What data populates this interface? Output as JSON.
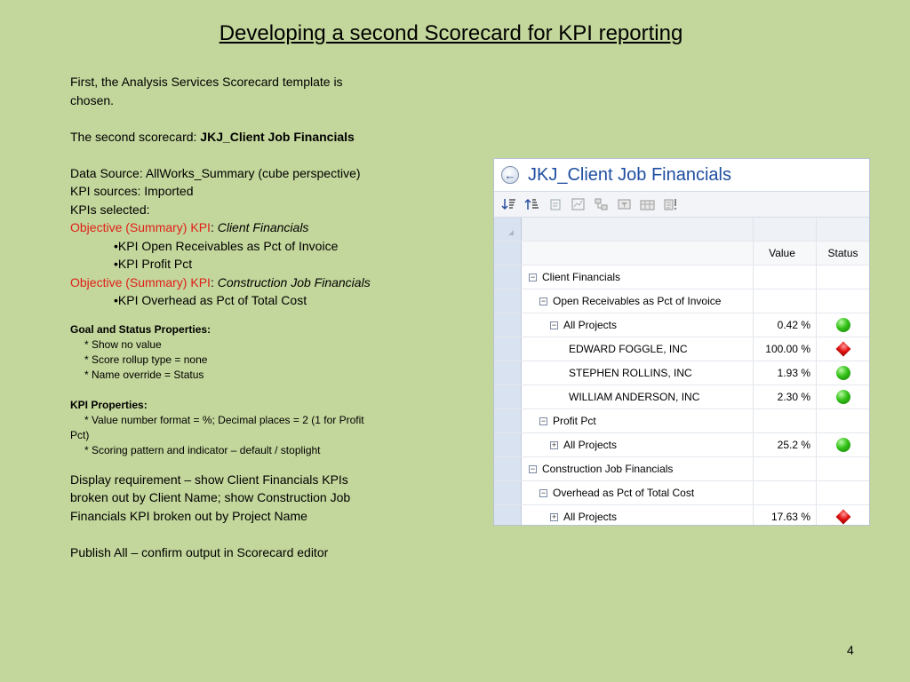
{
  "slide": {
    "title": "Developing a second Scorecard for KPI reporting",
    "page_number": "4"
  },
  "text": {
    "intro1": "First, the Analysis Services Scorecard template is chosen.",
    "second_label": "The second scorecard: ",
    "second_name": "JKJ_Client Job Financials",
    "datasource1": "Data Source: AllWorks_Summary (cube perspective)",
    "kpi_sources": "KPI sources: Imported",
    "kpis_selected": "KPIs selected:",
    "obj_label": "Objective (Summary) KPI",
    "colon": ": ",
    "obj1_name": "Client Financials",
    "kpi1": "•KPI Open Receivables as Pct of Invoice",
    "kpi2": "•KPI Profit Pct",
    "obj2_name": "Construction Job Financials",
    "kpi3": "•KPI Overhead as Pct of Total Cost",
    "goal_heading": "Goal and Status Properties:",
    "goal1": "* Show no value",
    "goal2": "* Score rollup type = none",
    "goal3": "* Name override = Status",
    "kpiprop_heading": "KPI Properties:",
    "kpiprop1": "* Value number format = %; Decimal places = 2 (1 for Profit Pct)",
    "kpiprop2": "* Scoring pattern and indicator – default / stoplight",
    "display_req": "Display requirement – show Client Financials KPIs broken out by Client Name; show Construction Job Financials KPI broken out by Project Name",
    "publish": "Publish All – confirm output in Scorecard editor"
  },
  "scorecard": {
    "title": "JKJ_Client Job Financials",
    "back_icon": "back-arrow-icon",
    "toolbar_icons": [
      "sort-descending-icon",
      "sort-ascending-icon",
      "properties-icon",
      "chart-icon",
      "hierarchy-icon",
      "filter-icon",
      "table-icon",
      "kpi-icon"
    ],
    "columns": {
      "value": "Value",
      "status": "Status"
    },
    "rows": [
      {
        "label": "Client Financials",
        "level": 0,
        "expander": "−",
        "value": "",
        "status": ""
      },
      {
        "label": "Open Receivables as Pct of Invoice",
        "level": 1,
        "expander": "−",
        "value": "",
        "status": ""
      },
      {
        "label": "All Projects",
        "level": 2,
        "expander": "−",
        "value": "0.42 %",
        "status": "green"
      },
      {
        "label": "EDWARD FOGGLE, INC",
        "level": 3,
        "expander": "",
        "value": "100.00 %",
        "status": "red"
      },
      {
        "label": "STEPHEN ROLLINS, INC",
        "level": 3,
        "expander": "",
        "value": "1.93 %",
        "status": "green"
      },
      {
        "label": "WILLIAM ANDERSON, INC",
        "level": 3,
        "expander": "",
        "value": "2.30 %",
        "status": "green"
      },
      {
        "label": "Profit Pct",
        "level": 1,
        "expander": "−",
        "value": "",
        "status": ""
      },
      {
        "label": "All Projects",
        "level": 2,
        "expander": "+",
        "value": "25.2 %",
        "status": "green"
      },
      {
        "label": "Construction Job Financials",
        "level": 0,
        "expander": "−",
        "value": "",
        "status": ""
      },
      {
        "label": "Overhead as Pct of Total Cost",
        "level": 1,
        "expander": "−",
        "value": "",
        "status": ""
      },
      {
        "label": "All Projects",
        "level": 2,
        "expander": "+",
        "value": "17.63 %",
        "status": "red"
      }
    ]
  }
}
